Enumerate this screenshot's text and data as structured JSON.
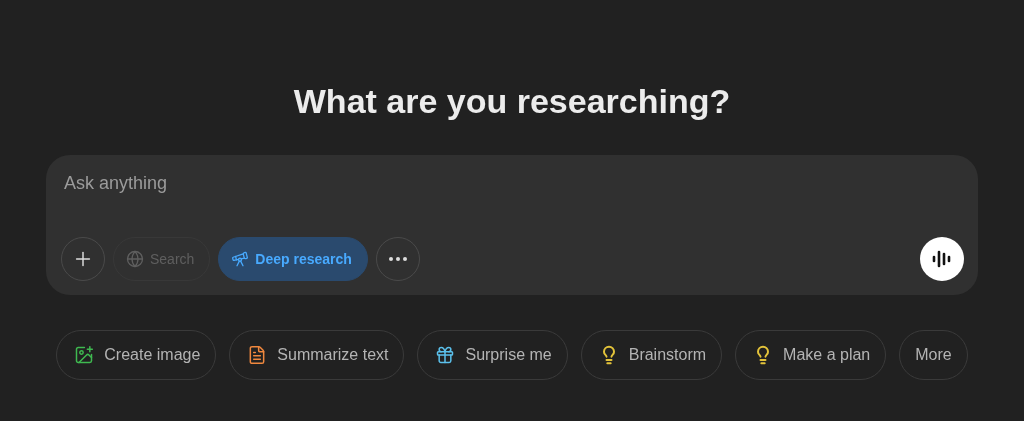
{
  "heading": "What are you researching?",
  "composer": {
    "placeholder": "Ask anything",
    "tools": [
      {
        "kind": "search",
        "label": "Search",
        "selected": false,
        "disabled": true
      },
      {
        "kind": "research",
        "label": "Deep research",
        "selected": true,
        "disabled": false
      }
    ]
  },
  "suggestions": [
    {
      "kind": "image",
      "label": "Create image",
      "color": "#3fb950"
    },
    {
      "kind": "document",
      "label": "Summarize text",
      "color": "#f0883e"
    },
    {
      "kind": "surprise",
      "label": "Surprise me",
      "color": "#5bc0eb"
    },
    {
      "kind": "idea",
      "label": "Brainstorm",
      "color": "#e3c33a"
    },
    {
      "kind": "idea",
      "label": "Make a plan",
      "color": "#e3c33a"
    },
    {
      "kind": "more",
      "label": "More"
    }
  ]
}
